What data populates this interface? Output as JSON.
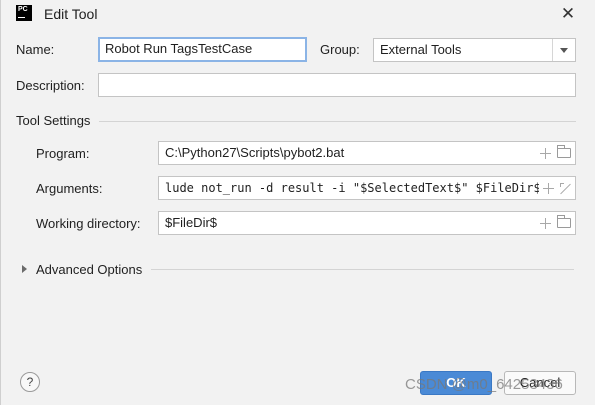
{
  "window": {
    "app_icon": "PC",
    "title": "Edit Tool",
    "close_glyph": "✕"
  },
  "form": {
    "name_label": "Name:",
    "name_value": "Robot Run TagsTestCase",
    "group_label": "Group:",
    "group_value": "External Tools",
    "description_label": "Description:",
    "description_value": ""
  },
  "tool_settings": {
    "section_title": "Tool Settings",
    "program_label": "Program:",
    "program_value": "C:\\Python27\\Scripts\\pybot2.bat",
    "arguments_label": "Arguments:",
    "arguments_value": "lude not_run -d result -i \"$SelectedText$\" $FileDir$",
    "working_dir_label": "Working directory:",
    "working_dir_value": "$FileDir$"
  },
  "advanced": {
    "label": "Advanced Options"
  },
  "buttons": {
    "help": "?",
    "ok": "OK",
    "cancel": "Cancel"
  },
  "watermark": "CSDN @m0_64253436",
  "icons": {
    "add": "plus-icon",
    "browse": "folder-icon",
    "expand": "expand-icon",
    "dropdown": "chevron-down-icon"
  },
  "colors": {
    "ok_button": "#4a8ad6",
    "focus_border": "#8bb4e6"
  }
}
